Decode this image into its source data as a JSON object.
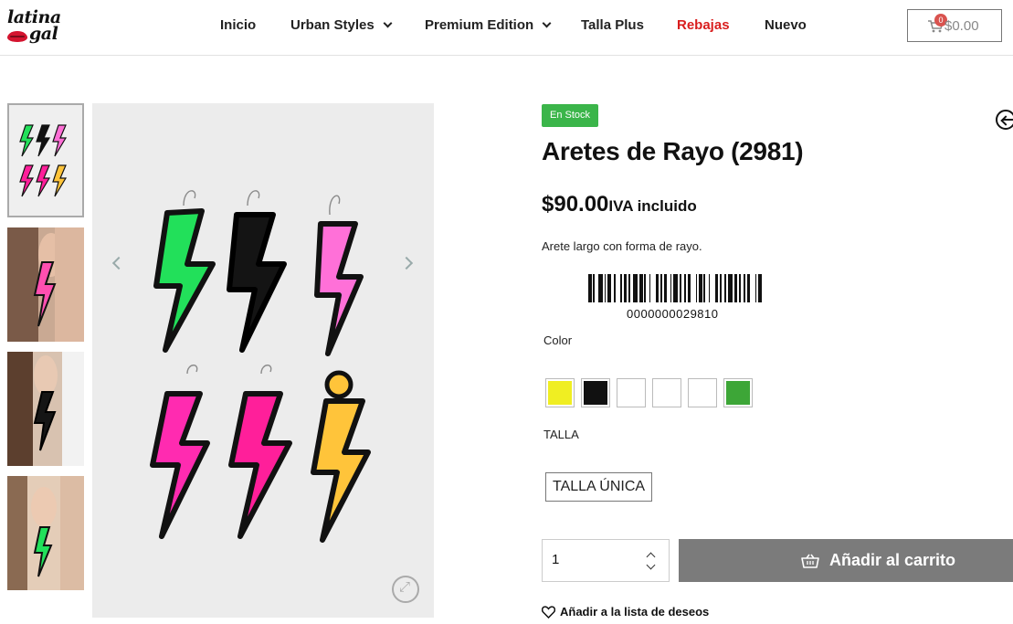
{
  "brand": {
    "logo_line1": "latina",
    "logo_line2": "gal"
  },
  "nav": {
    "items": [
      {
        "label": "Inicio"
      },
      {
        "label": "Urban Styles"
      },
      {
        "label": "Premium Edition"
      },
      {
        "label": "Talla Plus"
      },
      {
        "label": "Rebajas"
      },
      {
        "label": "Nuevo"
      }
    ]
  },
  "cart": {
    "count": "0",
    "total": "$0.00"
  },
  "product": {
    "stock_badge": "En Stock",
    "title": "Aretes de Rayo (2981)",
    "price": "$90.00",
    "tax_note": "IVA incluido",
    "description": "Arete largo con forma de rayo.",
    "barcode_number": "0000000029810",
    "color_label": "Color",
    "colors": [
      {
        "name": "yellow",
        "hex": "#f0ee22"
      },
      {
        "name": "black",
        "hex": "#111111"
      },
      {
        "name": "white-1",
        "hex": "#ffffff"
      },
      {
        "name": "white-2",
        "hex": "#ffffff"
      },
      {
        "name": "white-3",
        "hex": "#ffffff"
      },
      {
        "name": "green",
        "hex": "#3da637"
      }
    ],
    "size_label": "TALLA",
    "size_option": "TALLA ÚNICA",
    "quantity": "1",
    "add_to_cart": "Añadir al carrito",
    "wishlist": "Añadir a la lista de deseos"
  },
  "colors": {
    "stock_green": "#3bb54a",
    "sale_red": "#d91e1e",
    "button_gray": "#7b7b7b",
    "neon_green": "#22e05a",
    "neon_pink": "#ff4fd0",
    "hot_pink": "#ff1f9a",
    "neon_yellow": "#ffc43a"
  }
}
